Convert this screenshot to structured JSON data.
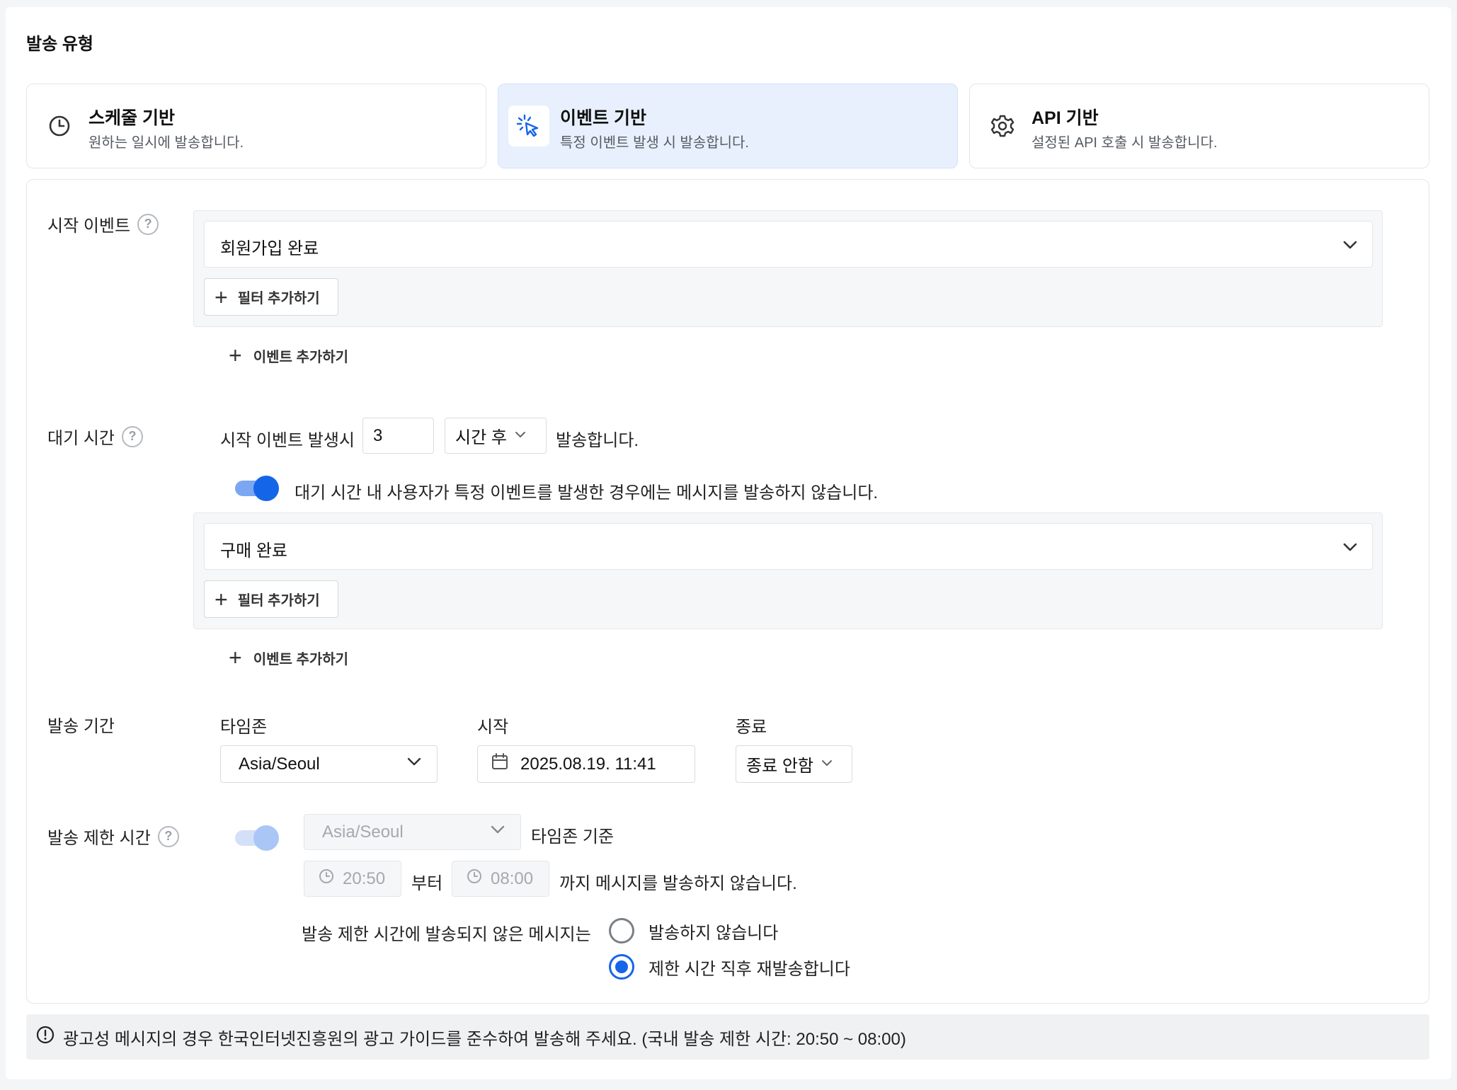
{
  "section": {
    "title": "발송 유형"
  },
  "types": [
    {
      "title": "스케줄 기반",
      "desc": "원하는 일시에 발송합니다.",
      "icon": "clock-icon"
    },
    {
      "title": "이벤트 기반",
      "desc": "특정 이벤트 발생 시 발송합니다.",
      "icon": "cursor-click-icon",
      "selected": true
    },
    {
      "title": "API 기반",
      "desc": "설정된 API 호출 시 발송합니다.",
      "icon": "gear-icon"
    }
  ],
  "colors": {
    "accent": "#1565e8",
    "selected_card_bg": "#e8f0fd"
  },
  "start_event": {
    "label": "시작 이벤트",
    "help": "?",
    "selected": "회원가입 완료",
    "filter_button": "필터 추가하기",
    "add_event_button": "이벤트 추가하기"
  },
  "wait": {
    "label": "대기 시간",
    "help": "?",
    "prefix": "시작 이벤트 발생시",
    "amount": "3",
    "unit": "시간 후",
    "suffix": "발송합니다.",
    "toggle_on": true,
    "toggle_text": "대기 시간 내 사용자가 특정 이벤트를 발생한 경우에는 메시지를 발송하지 않습니다.",
    "cancel_event": "구매 완료",
    "filter_button": "필터 추가하기",
    "add_event_button": "이벤트 추가하기"
  },
  "period": {
    "label": "발송 기간",
    "timezone_label": "타임존",
    "timezone": "Asia/Seoul",
    "start_label": "시작",
    "start": "2025.08.19. 11:41",
    "end_label": "종료",
    "end": "종료 안함"
  },
  "restrict": {
    "label": "발송 제한 시간",
    "help": "?",
    "toggle_on": true,
    "timezone": "Asia/Seoul",
    "timezone_suffix": "타임존 기준",
    "from": "20:50",
    "from_suffix": "부터",
    "to": "08:00",
    "to_suffix": "까지 메시지를 발송하지 않습니다.",
    "unsent_label": "발송 제한 시간에 발송되지 않은 메시지는",
    "options": [
      {
        "label": "발송하지 않습니다",
        "checked": false
      },
      {
        "label": "제한 시간 직후 재발송합니다",
        "checked": true
      }
    ]
  },
  "notice": {
    "text": "광고성 메시지의 경우 한국인터넷진흥원의 광고 가이드를 준수하여 발송해 주세요. (국내 발송 제한 시간: 20:50 ~ 08:00)"
  }
}
